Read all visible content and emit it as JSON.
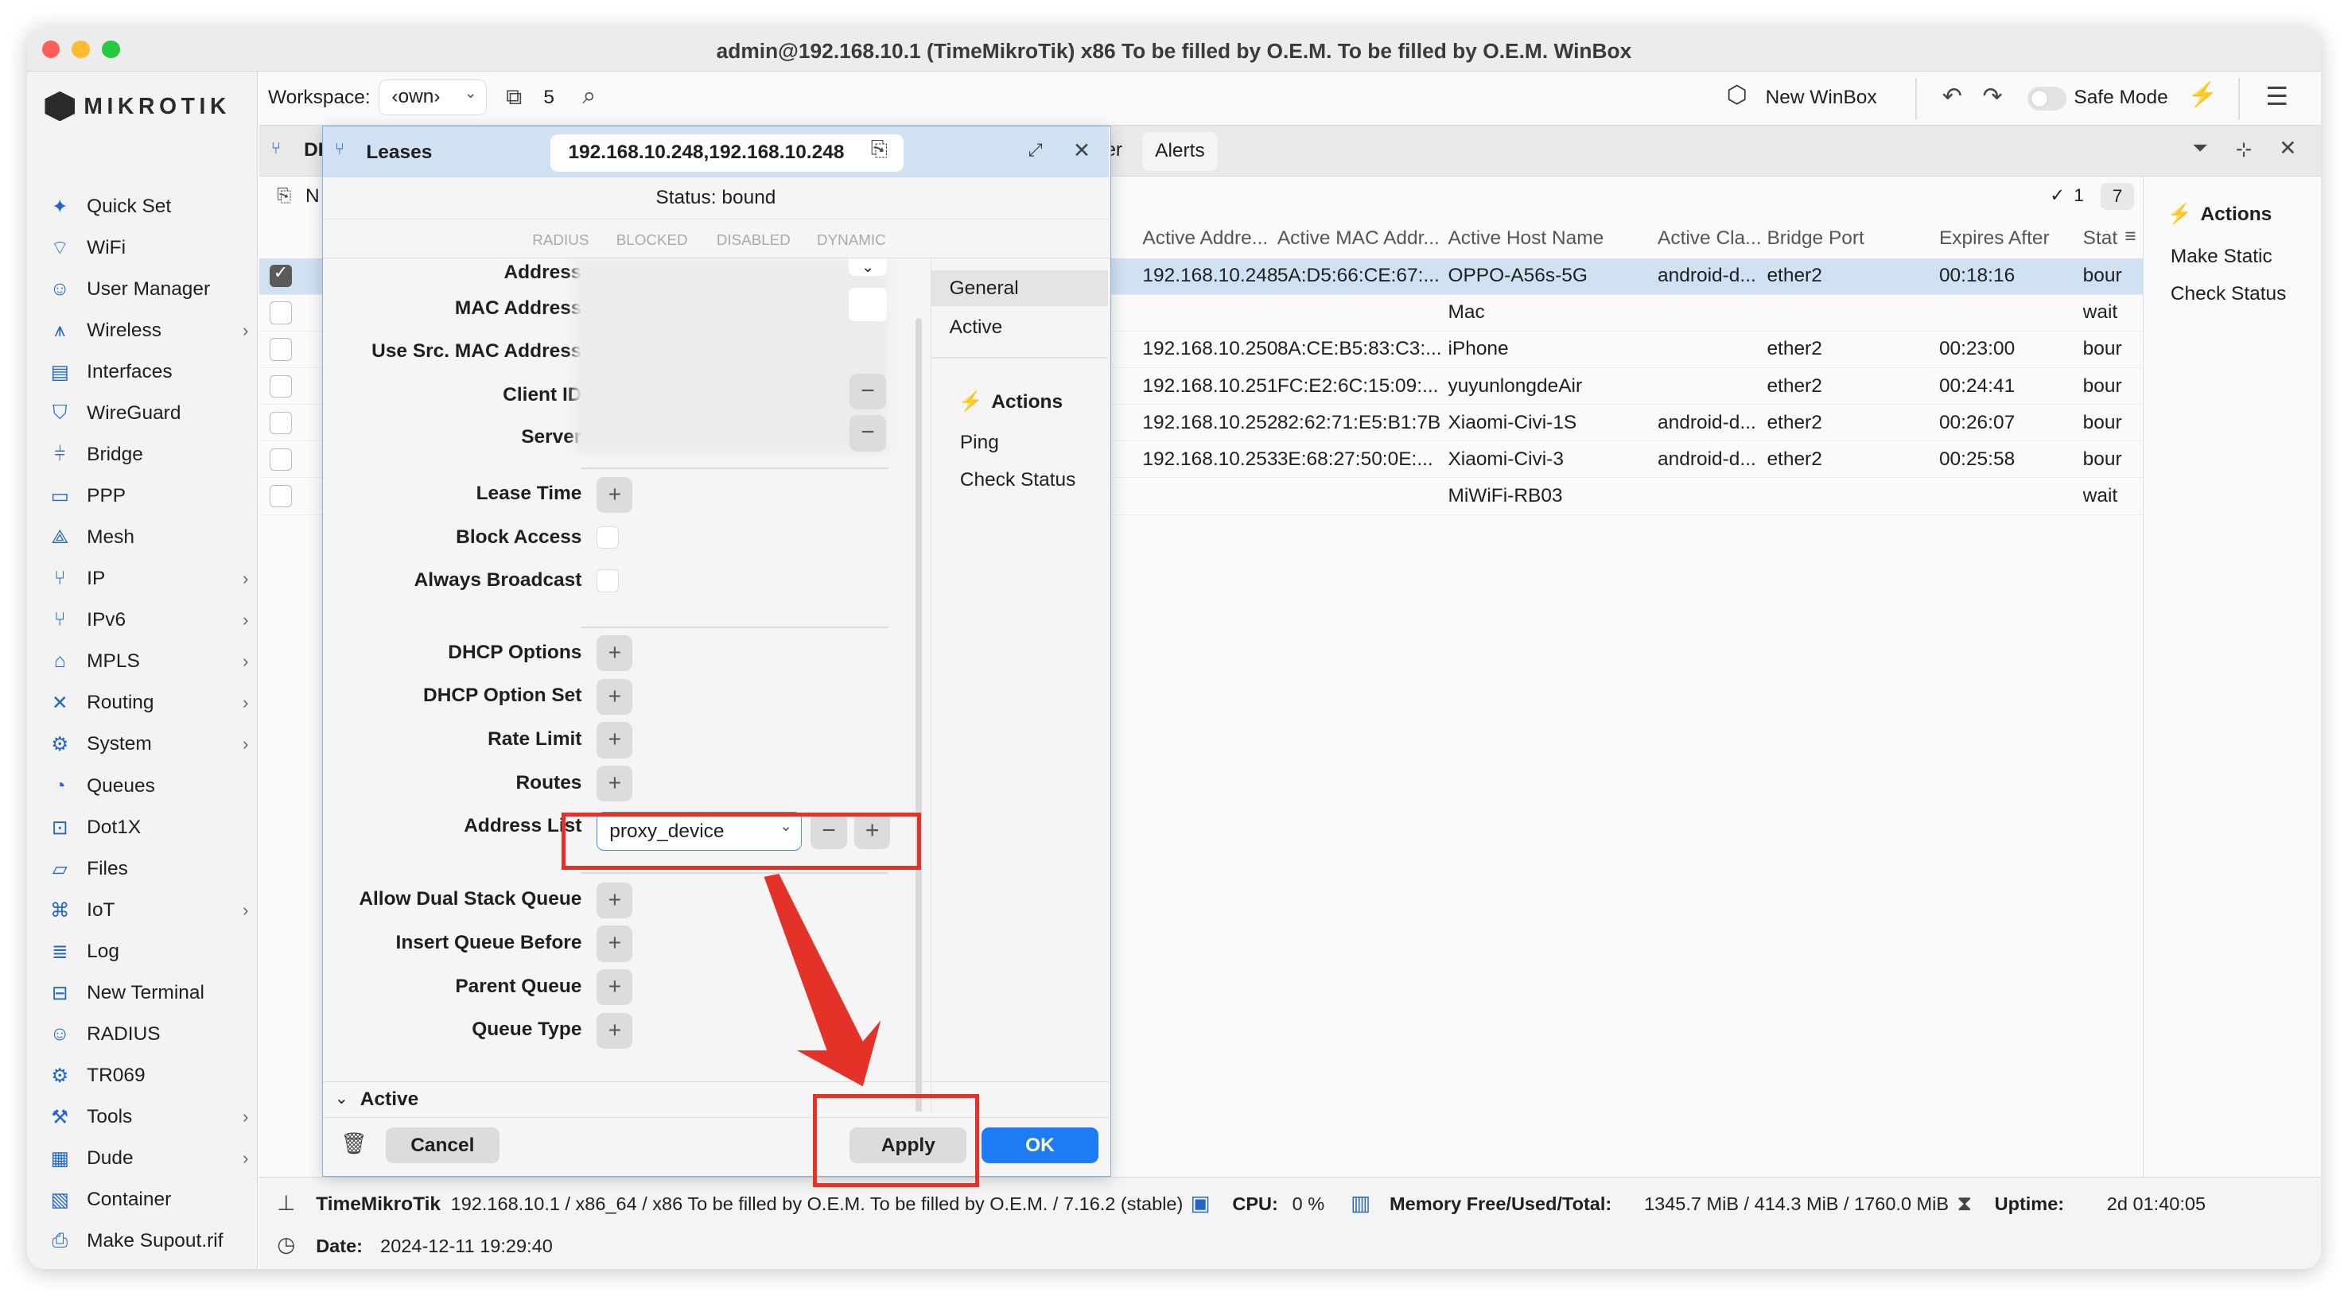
{
  "window": {
    "title": "admin@192.168.10.1 (TimeMikroTik) x86 To be filled by O.E.M. To be filled by O.E.M. WinBox"
  },
  "brand": {
    "logo": "MikroTik",
    "accent": "#1e7cf2",
    "highlight": "#e53228"
  },
  "sidebar": {
    "items": [
      {
        "label": "Quick Set",
        "icon": "wand-icon",
        "arrow": false
      },
      {
        "label": "WiFi",
        "icon": "wifi-icon",
        "arrow": false
      },
      {
        "label": "User Manager",
        "icon": "users-icon",
        "arrow": false
      },
      {
        "label": "Wireless",
        "icon": "antenna-icon",
        "arrow": true
      },
      {
        "label": "Interfaces",
        "icon": "interfaces-icon",
        "arrow": false
      },
      {
        "label": "WireGuard",
        "icon": "shield-icon",
        "arrow": false
      },
      {
        "label": "Bridge",
        "icon": "bridge-icon",
        "arrow": false
      },
      {
        "label": "PPP",
        "icon": "ppp-icon",
        "arrow": false
      },
      {
        "label": "Mesh",
        "icon": "mesh-icon",
        "arrow": false
      },
      {
        "label": "IP",
        "icon": "ip-icon",
        "arrow": true
      },
      {
        "label": "IPv6",
        "icon": "ipv6-icon",
        "arrow": true
      },
      {
        "label": "MPLS",
        "icon": "tag-icon",
        "arrow": true
      },
      {
        "label": "Routing",
        "icon": "routing-icon",
        "arrow": true
      },
      {
        "label": "System",
        "icon": "gear-icon",
        "arrow": true
      },
      {
        "label": "Queues",
        "icon": "queues-icon",
        "arrow": false
      },
      {
        "label": "Dot1X",
        "icon": "dot1x-icon",
        "arrow": false
      },
      {
        "label": "Files",
        "icon": "folder-icon",
        "arrow": false
      },
      {
        "label": "IoT",
        "icon": "iot-icon",
        "arrow": true
      },
      {
        "label": "Log",
        "icon": "log-icon",
        "arrow": false
      },
      {
        "label": "New Terminal",
        "icon": "terminal-icon",
        "arrow": false
      },
      {
        "label": "RADIUS",
        "icon": "radius-icon",
        "arrow": false
      },
      {
        "label": "TR069",
        "icon": "gear-icon",
        "arrow": false
      },
      {
        "label": "Tools",
        "icon": "tools-icon",
        "arrow": true
      },
      {
        "label": "Dude",
        "icon": "dude-icon",
        "arrow": true
      },
      {
        "label": "Container",
        "icon": "container-icon",
        "arrow": false
      },
      {
        "label": "Make Supout.rif",
        "icon": "file-icon",
        "arrow": false
      }
    ]
  },
  "toolbar": {
    "workspace_label": "Workspace:",
    "workspace_value": "‹own›",
    "windows_count": "5",
    "new_winbox": "New WinBox",
    "safe_mode": "Safe Mode"
  },
  "tabs": {
    "first": "DH",
    "partial": "er",
    "alerts": "Alerts",
    "new_partial": "N"
  },
  "table": {
    "count_checked": "1",
    "count_total": "7",
    "headers": {
      "addr": "Active Addre...",
      "mac": "Active MAC Addr...",
      "host": "Active Host Name",
      "class": "Active Cla...",
      "port": "Bridge Port",
      "expires": "Expires After",
      "status": "Stat"
    },
    "rows": [
      {
        "checked": true,
        "addr": "192.168.10.248",
        "mac": "5A:D5:66:CE:67:...",
        "host": "OPPO-A56s-5G",
        "class": "android-d...",
        "port": "ether2",
        "expires": "00:18:16",
        "status": "bour"
      },
      {
        "checked": false,
        "addr": "",
        "mac": "",
        "host": "Mac",
        "class": "",
        "port": "",
        "expires": "",
        "status": "wait"
      },
      {
        "checked": false,
        "addr": "192.168.10.250",
        "mac": "8A:CE:B5:83:C3:...",
        "host": "iPhone",
        "class": "",
        "port": "ether2",
        "expires": "00:23:00",
        "status": "bour"
      },
      {
        "checked": false,
        "addr": "192.168.10.251",
        "mac": "FC:E2:6C:15:09:...",
        "host": "yuyunlongdeAir",
        "class": "",
        "port": "ether2",
        "expires": "00:24:41",
        "status": "bour"
      },
      {
        "checked": false,
        "addr": "192.168.10.252",
        "mac": "82:62:71:E5:B1:7B",
        "host": "Xiaomi-Civi-1S",
        "class": "android-d...",
        "port": "ether2",
        "expires": "00:26:07",
        "status": "bour"
      },
      {
        "checked": false,
        "addr": "192.168.10.253",
        "mac": "3E:68:27:50:0E:...",
        "host": "Xiaomi-Civi-3",
        "class": "android-d...",
        "port": "ether2",
        "expires": "00:25:58",
        "status": "bour"
      },
      {
        "checked": false,
        "addr": "",
        "mac": "",
        "host": "MiWiFi-RB03",
        "class": "",
        "port": "",
        "expires": "",
        "status": "wait"
      }
    ]
  },
  "right_panel": {
    "title": "Actions",
    "items": [
      "Make Static",
      "Check Status"
    ]
  },
  "dialog": {
    "title": "Leases",
    "address": "192.168.10.248,192.168.10.248",
    "status": "Status: bound",
    "flags": [
      "RADIUS",
      "BLOCKED",
      "DISABLED",
      "DYNAMIC"
    ],
    "nav": [
      "General",
      "Active"
    ],
    "actions_title": "Actions",
    "actions": [
      "Ping",
      "Check Status"
    ],
    "fields_top": [
      "Address",
      "MAC Address",
      "Use Src. MAC Address",
      "Client ID",
      "Server"
    ],
    "lease_time": "Lease Time",
    "block_access": "Block Access",
    "always_broadcast": "Always Broadcast",
    "dhcp_options": "DHCP Options",
    "dhcp_option_set": "DHCP Option Set",
    "rate_limit": "Rate Limit",
    "routes": "Routes",
    "address_list_label": "Address List",
    "address_list_value": "proxy_device",
    "allow_dual": "Allow Dual Stack Queue",
    "insert_queue": "Insert Queue Before",
    "parent_queue": "Parent Queue",
    "queue_type": "Queue Type",
    "active_section": "Active",
    "cancel": "Cancel",
    "apply": "Apply",
    "ok": "OK"
  },
  "statusbar": {
    "router": "TimeMikroTik",
    "info": "192.168.10.1 / x86_64 / x86 To be filled by O.E.M. To be filled by O.E.M. / 7.16.2 (stable)",
    "cpu_label": "CPU:",
    "cpu": "0 %",
    "mem_label": "Memory Free/Used/Total:",
    "mem": "1345.7 MiB / 414.3 MiB / 1760.0 MiB",
    "uptime_label": "Uptime:",
    "uptime": "2d 01:40:05",
    "date_label": "Date:",
    "date": "2024-12-11 19:29:40"
  }
}
